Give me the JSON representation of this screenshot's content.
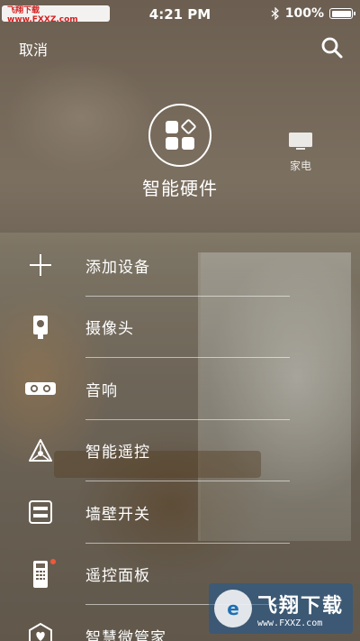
{
  "status_bar": {
    "carrier_badge": "飞翔下载 www.FXXZ.com",
    "time": "4:21 PM",
    "battery": "100%"
  },
  "header": {
    "cancel_label": "取消",
    "search_icon": "search-icon"
  },
  "categories": {
    "hardware": {
      "label": "智能硬件",
      "icon": "smart-hardware-icon"
    },
    "appliance": {
      "label": "家电",
      "icon": "tv-icon"
    }
  },
  "menu": {
    "items": [
      {
        "label": "添加设备",
        "icon": "plus-icon"
      },
      {
        "label": "摄像头",
        "icon": "camera-icon"
      },
      {
        "label": "音响",
        "icon": "speaker-icon"
      },
      {
        "label": "智能遥控",
        "icon": "smart-remote-icon"
      },
      {
        "label": "墙壁开关",
        "icon": "wall-switch-icon"
      },
      {
        "label": "遥控面板",
        "icon": "remote-panel-icon",
        "badge_dot": true
      },
      {
        "label": "智慧微管家",
        "icon": "smart-butler-icon"
      }
    ]
  },
  "watermark": {
    "title": "飞翔下载",
    "url": "www.FXXZ.com"
  },
  "colors": {
    "badge_red": "#f0583a",
    "watermark_blue": "#1e6fb4"
  }
}
